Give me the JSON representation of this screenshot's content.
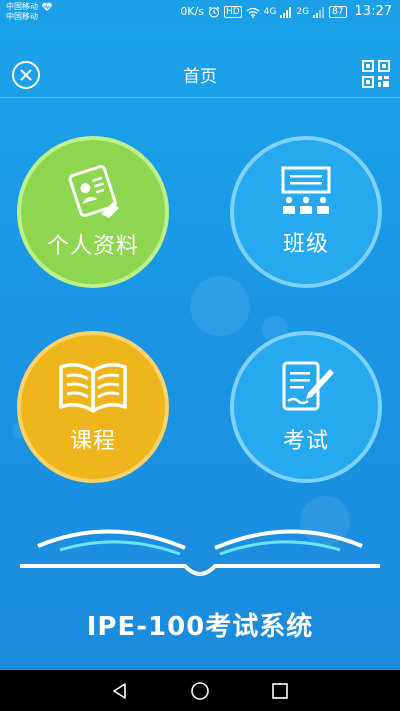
{
  "status_bar": {
    "carrier_1": "中国移动",
    "carrier_2": "中国移动",
    "speed": "0K/s",
    "hd": "HD",
    "net_a": "4G",
    "net_b": "2G",
    "battery": "87",
    "time": "13:27"
  },
  "header": {
    "title": "首页"
  },
  "tiles": {
    "profile": "个人资料",
    "class": "班级",
    "course": "课程",
    "exam": "考试"
  },
  "footer": {
    "app_name": "IPE-100考试系统"
  },
  "colors": {
    "background": "#1b9ae6",
    "profile": "#8fd650",
    "class": "#27a9f0",
    "course": "#efb51d",
    "exam": "#27a9f0"
  },
  "icons": {
    "status": [
      "heart-pulse-icon",
      "alarm-icon",
      "wifi-icon",
      "signal-icon",
      "battery-icon"
    ],
    "header": [
      "close-icon",
      "qr-code-icon"
    ],
    "tiles": [
      "id-card-icon",
      "classroom-icon",
      "book-icon",
      "exam-paper-icon"
    ],
    "nav": [
      "back-icon",
      "home-icon",
      "recents-icon"
    ]
  }
}
